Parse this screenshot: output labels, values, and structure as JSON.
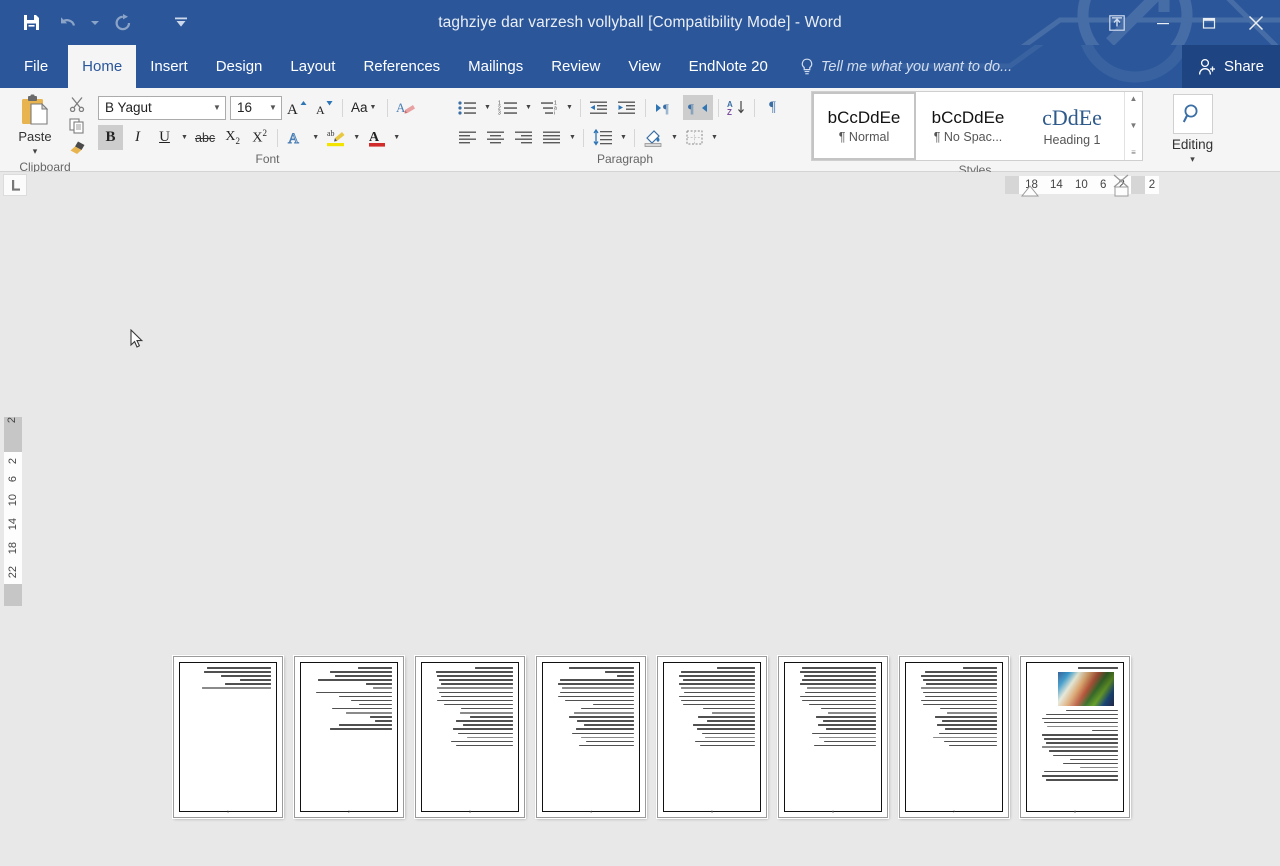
{
  "window": {
    "title": "taghziye dar varzesh vollyball [Compatibility Mode] - Word",
    "quick_access": [
      {
        "name": "save",
        "icon": "save-icon",
        "label": "Save",
        "enabled": true
      },
      {
        "name": "undo",
        "icon": "undo-icon",
        "label": "Undo",
        "enabled": false
      },
      {
        "name": "undo-dropdown",
        "icon": "chevron-down-icon",
        "label": "Undo options",
        "enabled": false
      },
      {
        "name": "redo",
        "icon": "redo-icon",
        "label": "Redo",
        "enabled": false
      },
      {
        "name": "customize",
        "icon": "customize-qat-icon",
        "label": "Customize Quick Access Toolbar",
        "enabled": true
      }
    ],
    "controls": {
      "ribbon_display": "Ribbon Display Options",
      "minimize": "Minimize",
      "restore": "Restore Down",
      "close": "Close"
    }
  },
  "tabs": [
    {
      "label": "File",
      "active": false
    },
    {
      "label": "Home",
      "active": true
    },
    {
      "label": "Insert",
      "active": false
    },
    {
      "label": "Design",
      "active": false
    },
    {
      "label": "Layout",
      "active": false
    },
    {
      "label": "References",
      "active": false
    },
    {
      "label": "Mailings",
      "active": false
    },
    {
      "label": "Review",
      "active": false
    },
    {
      "label": "View",
      "active": false
    },
    {
      "label": "EndNote 20",
      "active": false
    }
  ],
  "tell_me": {
    "placeholder": "Tell me what you want to do...",
    "icon": "lightbulb-icon"
  },
  "share": {
    "label": "Share",
    "icon": "share-person-icon"
  },
  "ribbon": {
    "clipboard": {
      "label": "Clipboard",
      "paste": {
        "label": "Paste",
        "arrow": "▾"
      },
      "cut": "Cut",
      "copy": "Copy",
      "format_painter": "Format Painter"
    },
    "font": {
      "label": "Font",
      "font_name": {
        "value": "B Yagut",
        "placeholder": "Font"
      },
      "font_size": {
        "value": "16",
        "placeholder": "Size"
      },
      "grow": "A",
      "shrink": "A",
      "change_case": "Aa",
      "clear_formatting": "Clear All Formatting",
      "bold": {
        "label": "B",
        "active": true
      },
      "italic": {
        "label": "I",
        "active": false
      },
      "underline": {
        "label": "U",
        "active": false
      },
      "strikethrough": {
        "label": "abc",
        "active": false
      },
      "subscript": {
        "label": "X",
        "sub": "2",
        "active": false
      },
      "superscript": {
        "label": "X",
        "sup": "2",
        "active": false
      },
      "text_effects": {
        "label": "A",
        "active": false
      },
      "highlight": {
        "label": "ab",
        "active": false
      },
      "font_color": {
        "label": "A",
        "active": false,
        "color": "#d22b2b"
      }
    },
    "paragraph": {
      "label": "Paragraph",
      "bullets": "Bullets",
      "numbering": "Numbering",
      "multilevel": "Multilevel List",
      "decrease_indent": "Decrease Indent",
      "increase_indent": "Increase Indent",
      "ltr": {
        "label": "Left-to-Right Text Direction",
        "active": false
      },
      "rtl": {
        "label": "Right-to-Left Text Direction",
        "active": true
      },
      "sort": "Sort",
      "show_marks": "Show/Hide ¶",
      "align_left": "Align Left",
      "align_center": "Center",
      "align_right": "Align Right",
      "justify": "Justify",
      "line_spacing": "Line and Paragraph Spacing",
      "shading": "Shading",
      "borders": "Borders"
    },
    "styles": {
      "label": "Styles",
      "items": [
        {
          "preview": "bCcDdEe",
          "name": "¶ Normal",
          "selected": true,
          "serif": false
        },
        {
          "preview": "bCcDdEe",
          "name": "¶ No Spac...",
          "selected": false,
          "serif": false
        },
        {
          "preview": "cDdEe",
          "name": "Heading 1",
          "selected": false,
          "serif": true
        }
      ],
      "scroll_up": "▲",
      "scroll_down": "▼",
      "more": "▾"
    },
    "editing": {
      "label": "Editing",
      "icon": "search-icon",
      "arrow": "▾"
    }
  },
  "rulers": {
    "tab_selector": {
      "type": "left-tab",
      "glyph": "L"
    },
    "horizontal_numbers": [
      "18",
      "14",
      "10",
      "6",
      "2",
      "2"
    ],
    "vertical_numbers": [
      "2",
      "2",
      "6",
      "10",
      "14",
      "18",
      "22"
    ]
  },
  "document": {
    "view": "multiple-pages",
    "page_count": 8,
    "pages": [
      {
        "number": 1,
        "lines": [
          74,
          78,
          58,
          36,
          54,
          80
        ],
        "blank_after": true,
        "image": false
      },
      {
        "number": 2,
        "lines": [
          40,
          72,
          66,
          86,
          30,
          22,
          88,
          62,
          48,
          38,
          70,
          54,
          26,
          20,
          62,
          72
        ],
        "image": false
      },
      {
        "number": 3,
        "lines": [
          44,
          90,
          88,
          86,
          84,
          88,
          86,
          84,
          88,
          80,
          60,
          62,
          50,
          66,
          58,
          70,
          64,
          54,
          72,
          66
        ],
        "image": false
      },
      {
        "number": 4,
        "lines": [
          76,
          34,
          20,
          86,
          88,
          84,
          86,
          88,
          80,
          48,
          62,
          70,
          76,
          66,
          58,
          68,
          72,
          62,
          56,
          64
        ],
        "image": false
      },
      {
        "number": 5,
        "lines": [
          44,
          86,
          88,
          84,
          88,
          86,
          82,
          88,
          86,
          84,
          60,
          50,
          66,
          56,
          72,
          68,
          62,
          58,
          70,
          64
        ],
        "image": false
      },
      {
        "number": 6,
        "lines": [
          86,
          88,
          84,
          86,
          88,
          80,
          82,
          88,
          86,
          78,
          64,
          56,
          70,
          62,
          68,
          58,
          74,
          66,
          60,
          72
        ],
        "image": false
      },
      {
        "number": 7,
        "lines": [
          40,
          84,
          88,
          86,
          82,
          88,
          86,
          84,
          88,
          86,
          66,
          58,
          72,
          64,
          70,
          60,
          68,
          74,
          62,
          56
        ],
        "image": false
      },
      {
        "number": 8,
        "lines": [
          46,
          60,
          84,
          88,
          86,
          82,
          30,
          88,
          86,
          84,
          88,
          80,
          76,
          56,
          64,
          44,
          86,
          88,
          84
        ],
        "image": true
      }
    ]
  }
}
